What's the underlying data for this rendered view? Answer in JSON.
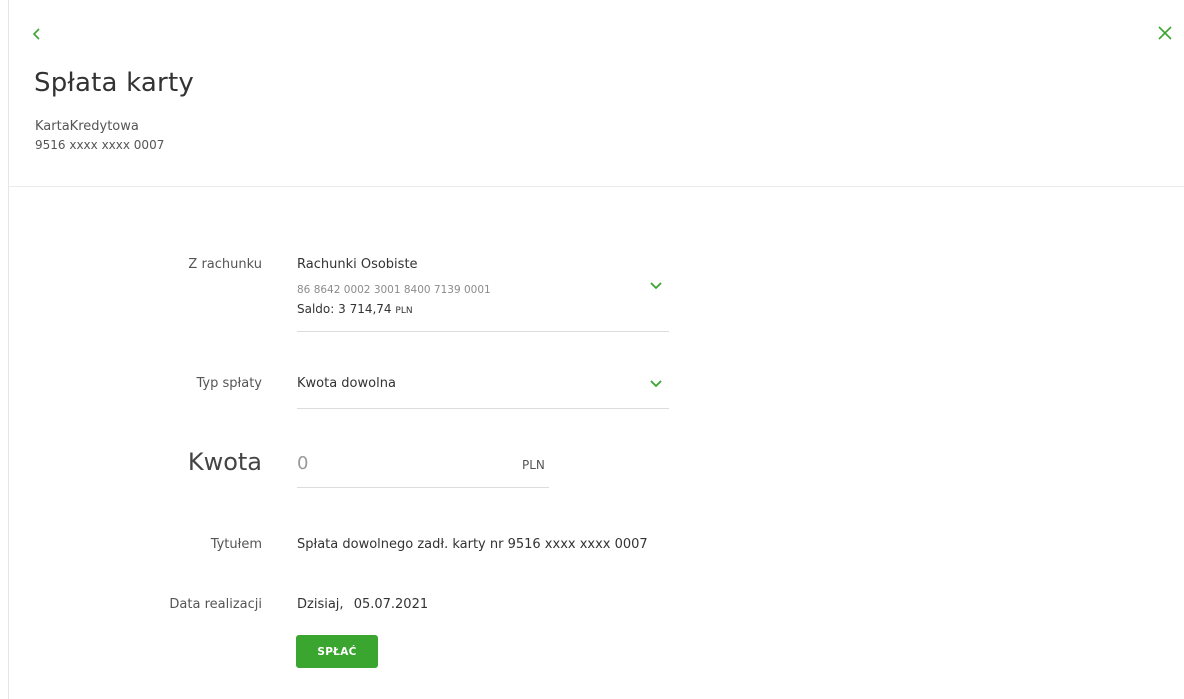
{
  "header": {
    "title": "Spłata karty",
    "card_name": "KartaKredytowa",
    "card_number": "9516 xxxx xxxx 0007"
  },
  "icons": {
    "back": "chevron-left-icon",
    "close": "close-icon",
    "dropdown": "chevron-down-icon"
  },
  "colors": {
    "accent": "#3aa52f",
    "text": "#333333",
    "muted": "#8c8c8c",
    "divider": "#ebebeb"
  },
  "form": {
    "account": {
      "label": "Z rachunku",
      "name": "Rachunki Osobiste",
      "number": "86 8642 0002 3001 8400 7139 0001",
      "balance_label": "Saldo: 3 714,74",
      "balance_currency": "PLN"
    },
    "repayment_type": {
      "label": "Typ spłaty",
      "value": "Kwota dowolna"
    },
    "amount": {
      "label": "Kwota",
      "placeholder": "0",
      "currency": "PLN"
    },
    "title": {
      "label": "Tytułem",
      "value": "Spłata dowolnego zadł. karty nr 9516 xxxx xxxx 0007"
    },
    "date": {
      "label": "Data realizacji",
      "day": "Dzisiaj,",
      "value": "05.07.2021"
    },
    "submit_label": "SPŁAĆ"
  }
}
